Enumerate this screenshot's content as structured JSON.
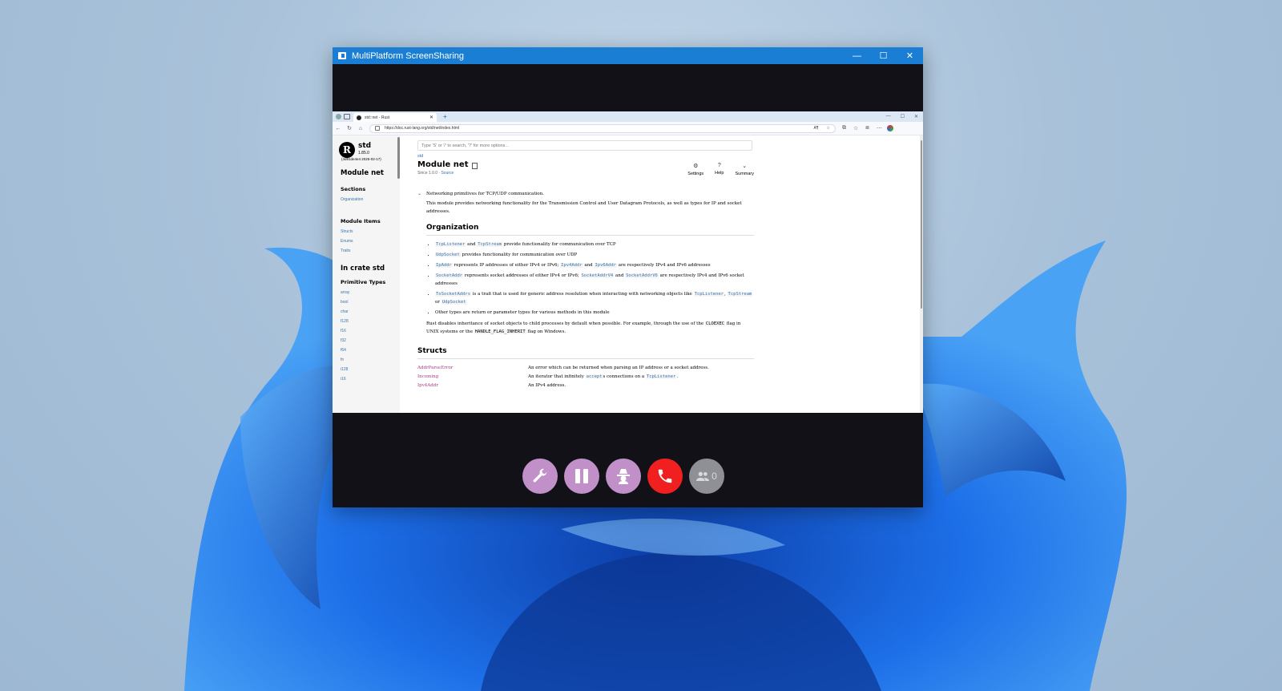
{
  "window": {
    "title": "MultiPlatform ScreenSharing",
    "controls": {
      "minimize": "—",
      "maximize": "☐",
      "close": "✕"
    }
  },
  "browser": {
    "tab_title": "std::net - Rust",
    "tab_close": "✕",
    "new_tab": "+",
    "url": "https://doc.rust-lang.org/std/net/index.html",
    "zoom": "A¶"
  },
  "sidebar": {
    "crate_name": "std",
    "crate_version": "1.85.0",
    "crate_build": "(4d91de4e4 2025-02-17)",
    "module_heading": "Module net",
    "sections_heading": "Sections",
    "sections": [
      "Organization"
    ],
    "module_items_heading": "Module Items",
    "module_items": [
      "Structs",
      "Enums",
      "Traits"
    ],
    "crate_heading": "In crate std",
    "primitive_heading": "Primitive Types",
    "primitives": [
      "array",
      "bool",
      "char",
      "f128",
      "f16",
      "f32",
      "f64",
      "fn",
      "i128",
      "i16"
    ]
  },
  "doc": {
    "search_placeholder": "Type 'S' or '/' to search, '?' for more options...",
    "breadcrumb": "std",
    "title": "Module net",
    "since": "Since 1.0.0 · ",
    "source": "Source",
    "tools": {
      "settings": "Settings",
      "help": "Help",
      "summary": "Summary"
    },
    "summary": "Networking primitives for TCP/UDP communication.",
    "intro": "This module provides networking functionality for the Transmission Control and User Datagram Protocols, as well as types for IP and socket addresses.",
    "organization_heading": "Organization",
    "org": {
      "l1_code1": "TcpListener",
      "l1_and": " and ",
      "l1_code2": "TcpStream",
      "l1_text": " provide functionality for communication over TCP",
      "l2_code": "UdpSocket",
      "l2_text": " provides functionality for communication over UDP",
      "l3_code1": "IpAddr",
      "l3_text1": " represents IP addresses of either IPv4 or IPv6; ",
      "l3_code2": "Ipv4Addr",
      "l3_and": " and ",
      "l3_code3": "Ipv6Addr",
      "l3_text2": " are respectively IPv4 and IPv6 addresses",
      "l4_code1": "SocketAddr",
      "l4_text1": " represents socket addresses of either IPv4 or IPv6; ",
      "l4_code2": "SocketAddrV4",
      "l4_and": " and ",
      "l4_code3": "SocketAddrV6",
      "l4_text2": " are respectively IPv4 and IPv6 socket addresses",
      "l5_code1": "ToSocketAddrs",
      "l5_text1": " is a trait that is used for generic address resolution when interacting with networking objects like ",
      "l5_code2": "TcpListener",
      "l5_sep": ", ",
      "l5_code3": "TcpStream",
      "l5_or": " or ",
      "l5_code4": "UdpSocket",
      "l6_text": "Other types are return or parameter types for various methods in this module"
    },
    "inherit": {
      "t1": "Rust disables inheritance of socket objects to child processes by default when possible. For example, through the use of the ",
      "c1": "CLOEXEC",
      "t2": " flag in UNIX systems or the ",
      "c2": "HANDLE_FLAG_INHERIT",
      "t3": " flag on Windows."
    },
    "structs_heading": "Structs",
    "structs": [
      {
        "name": "AddrParseError",
        "desc": "An error which can be returned when parsing an IP address or a socket address."
      },
      {
        "name": "Incoming",
        "desc_pre": "An iterator that infinitely ",
        "code1": "accept",
        "desc_mid": "s connections on a ",
        "code2": "TcpListener",
        "desc_post": "."
      },
      {
        "name": "Ipv4Addr",
        "desc": "An IPv4 address."
      }
    ]
  },
  "call_controls": {
    "viewer_count": "0",
    "icons": [
      "wrench-icon",
      "pause-icon",
      "incognito-icon",
      "phone-icon",
      "users-icon"
    ],
    "colors": {
      "button": "#c190c9",
      "hangup": "#f02020",
      "viewers": "#8f8f96"
    }
  },
  "colors": {
    "titlebar": "#1a7fd4",
    "link": "#3873ad",
    "struct": "#ad378a"
  }
}
